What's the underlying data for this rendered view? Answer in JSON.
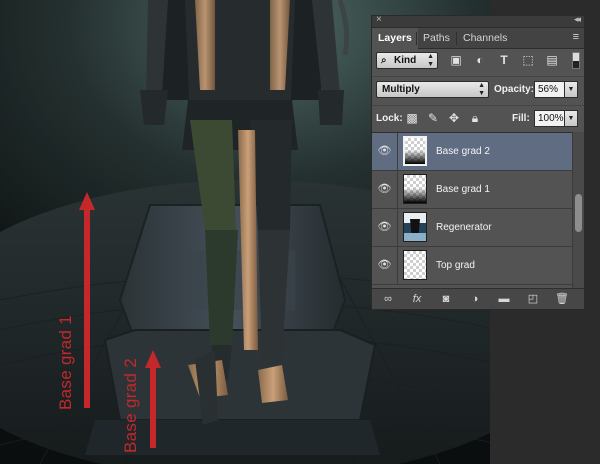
{
  "panel": {
    "tabs": [
      {
        "label": "Layers",
        "active": true
      },
      {
        "label": "Paths",
        "active": false
      },
      {
        "label": "Channels",
        "active": false
      }
    ],
    "filter": {
      "kind_label": "Kind"
    },
    "blend": {
      "mode": "Multiply",
      "opacity_label": "Opacity:",
      "opacity_value": "56%"
    },
    "lock": {
      "lock_label": "Lock:",
      "fill_label": "Fill:",
      "fill_value": "100%"
    },
    "layers": [
      {
        "name": "Base grad 2",
        "selected": true,
        "thumb": "gradient-bottom"
      },
      {
        "name": "Base grad 1",
        "selected": false,
        "thumb": "gradient-bottom"
      },
      {
        "name": "Regenerator",
        "selected": false,
        "thumb": "photo"
      },
      {
        "name": "Top grad",
        "selected": false,
        "thumb": "transparent"
      }
    ],
    "footer_icons": [
      "link-icon",
      "fx-icon",
      "mask-icon",
      "adjustment-icon",
      "group-folder-icon",
      "new-layer-icon",
      "trash-icon"
    ]
  },
  "annotations": {
    "arrow1_label": "Base grad 1",
    "arrow2_label": "Base grad 2",
    "arrow_color": "#c4282a"
  },
  "colors": {
    "panel_bg": "#535353",
    "selected_row": "#5f6c82",
    "accent_red": "#c4282a"
  }
}
